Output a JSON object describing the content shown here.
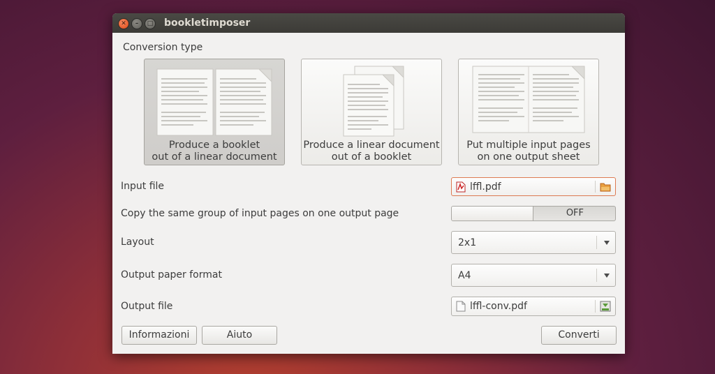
{
  "window": {
    "title": "bookletimposer"
  },
  "conversion": {
    "label": "Conversion type",
    "options": [
      {
        "line1": "Produce a booklet",
        "line2": "out of a linear document",
        "selected": true
      },
      {
        "line1": "Produce a linear document",
        "line2": "out of a booklet",
        "selected": false
      },
      {
        "line1": "Put multiple input pages",
        "line2": "on one output sheet",
        "selected": false
      }
    ]
  },
  "input_file": {
    "label": "Input file",
    "value": "lffl.pdf",
    "file_icon": "pdf-file-icon",
    "picker_icon": "folder-open-icon"
  },
  "copy_group": {
    "label": "Copy the same group of input pages on one output page",
    "state": "OFF"
  },
  "layout": {
    "label": "Layout",
    "value": "2x1"
  },
  "paper": {
    "label": "Output paper format",
    "value": "A4"
  },
  "output_file": {
    "label": "Output file",
    "value": "lffl-conv.pdf",
    "file_icon": "document-icon",
    "picker_icon": "save-icon"
  },
  "buttons": {
    "info": "Informazioni",
    "help": "Aiuto",
    "convert": "Converti"
  },
  "colors": {
    "accent": "#dd4814",
    "focus_border": "#dd7a52",
    "titlebar": "#3c3b37"
  }
}
